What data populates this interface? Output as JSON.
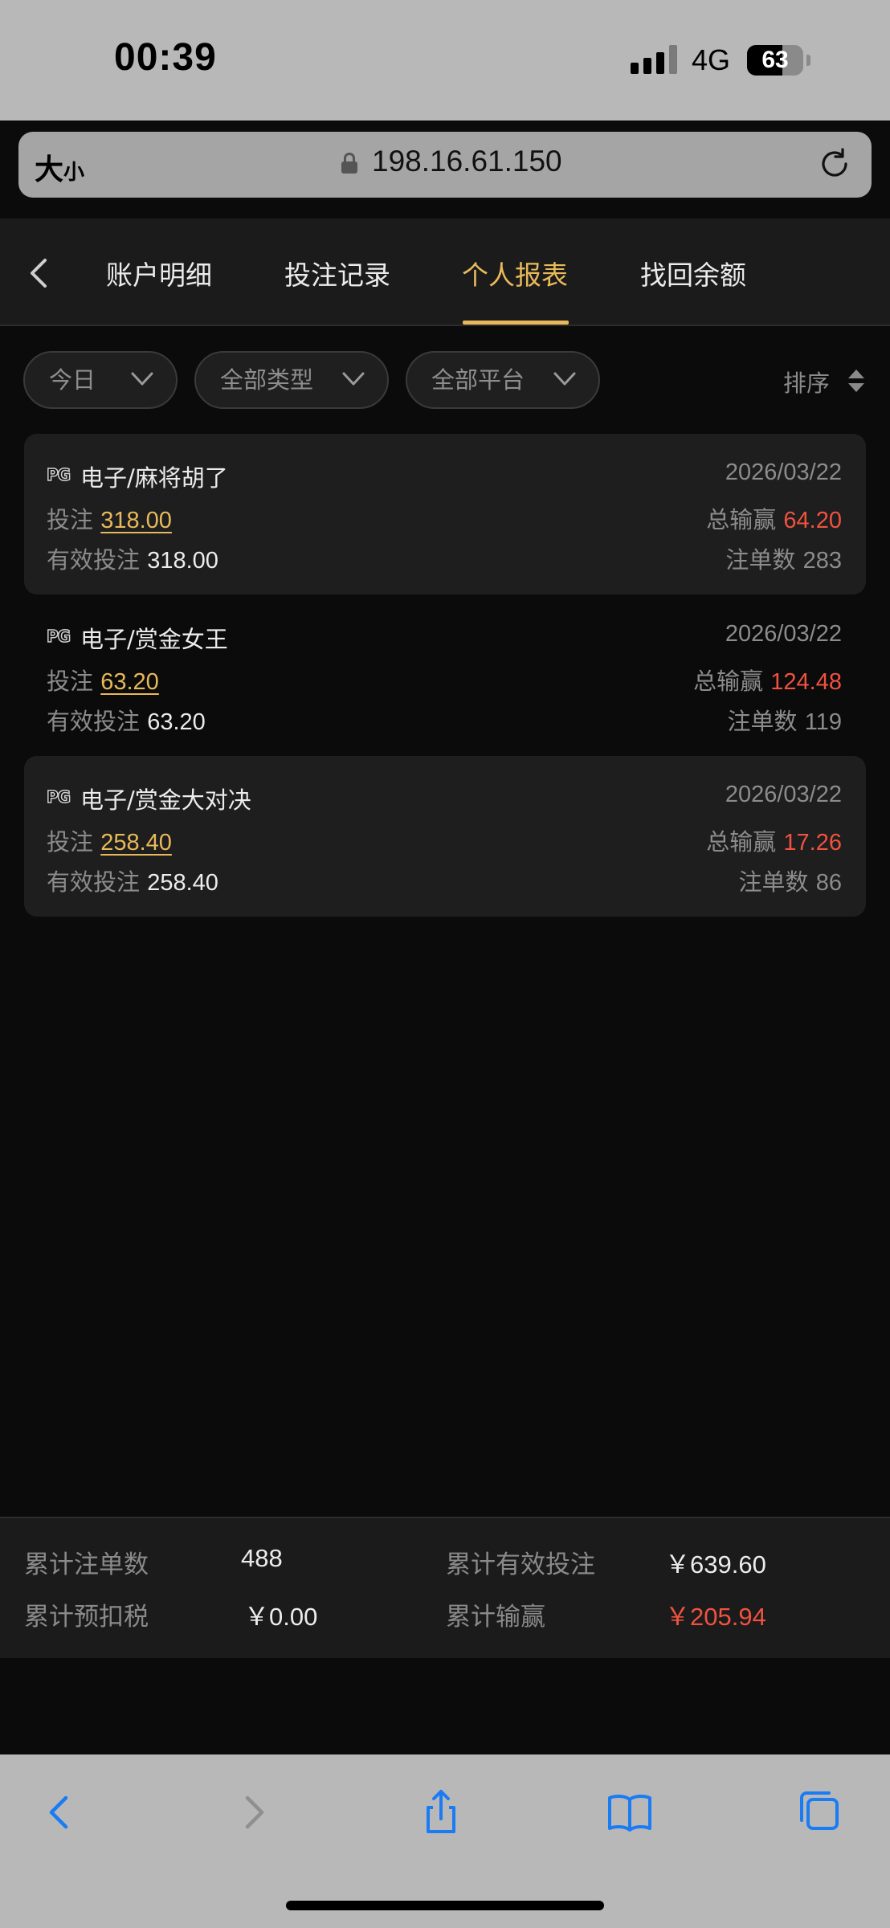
{
  "status_bar": {
    "time": "00:39",
    "network": "4G",
    "battery": "63",
    "battery_level": 0.63
  },
  "browser": {
    "text_size_label": "大",
    "text_size_small": "小",
    "url": "198.16.61.150"
  },
  "header": {
    "tabs": [
      {
        "label": "账户明细",
        "active": false
      },
      {
        "label": "投注记录",
        "active": false
      },
      {
        "label": "个人报表",
        "active": true
      },
      {
        "label": "找回余额",
        "active": false
      }
    ]
  },
  "filters": {
    "date": "今日",
    "type": "全部类型",
    "platform": "全部平台",
    "sort_label": "排序"
  },
  "labels": {
    "bet": "投注",
    "valid_bet": "有效投注",
    "total_win_loss": "总输赢",
    "bet_count": "注单数"
  },
  "records": [
    {
      "provider": "PG",
      "title": "电子/麻将胡了",
      "date": "2026/03/22",
      "bet": "318.00",
      "valid_bet": "318.00",
      "total_win_loss": "64.20",
      "bet_count": "283"
    },
    {
      "provider": "PG",
      "title": "电子/赏金女王",
      "date": "2026/03/22",
      "bet": "63.20",
      "valid_bet": "63.20",
      "total_win_loss": "124.48",
      "bet_count": "119"
    },
    {
      "provider": "PG",
      "title": "电子/赏金大对决",
      "date": "2026/03/22",
      "bet": "258.40",
      "valid_bet": "258.40",
      "total_win_loss": "17.26",
      "bet_count": "86"
    }
  ],
  "summary": {
    "total_bets_label": "累计注单数",
    "total_bets": "488",
    "total_valid_bet_label": "累计有效投注",
    "total_valid_bet": "￥639.60",
    "total_tax_label": "累计预扣税",
    "total_tax": "￥0.00",
    "total_win_loss_label": "累计输赢",
    "total_win_loss": "￥205.94"
  },
  "colors": {
    "accent_gold": "#e8b95a",
    "win_red": "#f0523f",
    "background": "#0b0b0b",
    "card": "#1e1e1e",
    "ios_blue": "#1a7cf5"
  }
}
